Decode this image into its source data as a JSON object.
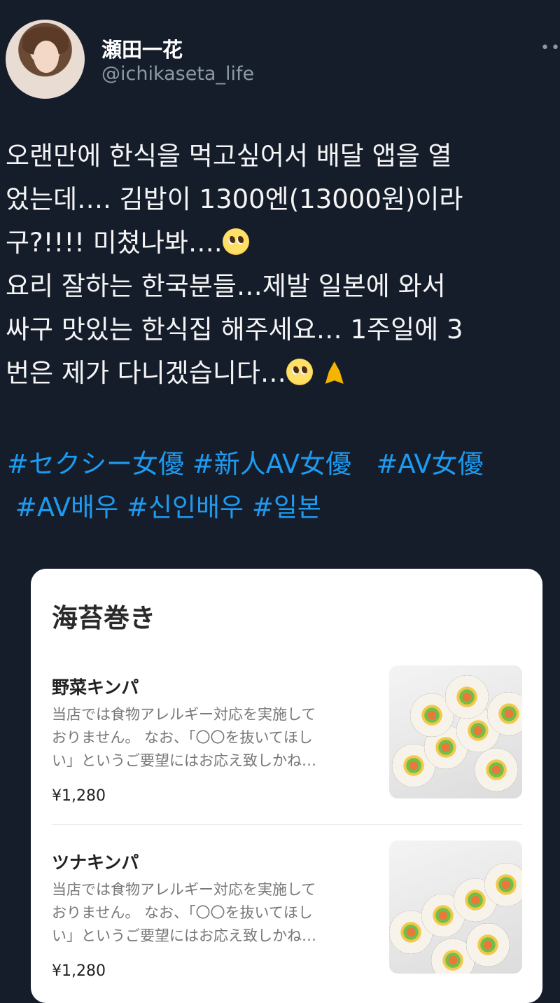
{
  "profile": {
    "display_name": "瀬田一花",
    "handle": "@ichikaseta_life",
    "more_icon": "more-horizontal-icon"
  },
  "tweet": {
    "lines": [
      "오랜만에 한식을 먹고싶어서 배달 앱을 열",
      "었는데…. 김밥이 1300엔(13000원)이라",
      "구?!!!! 미쳤나봐….",
      "요리 잘하는 한국분들…제발 일본에 와서",
      "싸구 맛있는 한식집 해주세요… 1주일에 3",
      "번은 제가 다니겠습니다…"
    ],
    "emojis": [
      "pleading-face",
      "pleading-face",
      "folded-hands"
    ]
  },
  "hashtags": {
    "line1": [
      "#セクシー女優",
      "#新人AV女優",
      "#AV女優"
    ],
    "line2": [
      "#AV배우",
      "#신인배우",
      "#일본"
    ]
  },
  "card": {
    "title": "海苔巻き",
    "items": [
      {
        "name": "野菜キンパ",
        "desc": [
          "当店では食物アレルギー対応を実施して",
          "おりません。 なお、「〇〇を抜いてほし",
          "い」というご要望にはお応え致しかね…"
        ],
        "price": "¥1,280"
      },
      {
        "name": "ツナキンパ",
        "desc": [
          "当店では食物アレルギー対応を実施して",
          "おりません。 なお、「〇〇を抜いてほし",
          "い」というご要望にはお応え致しかね…"
        ],
        "price": "¥1,280"
      }
    ]
  },
  "colors": {
    "background": "#151d2b",
    "hashtag": "#1d9bf0",
    "handle": "#8b98a5"
  }
}
